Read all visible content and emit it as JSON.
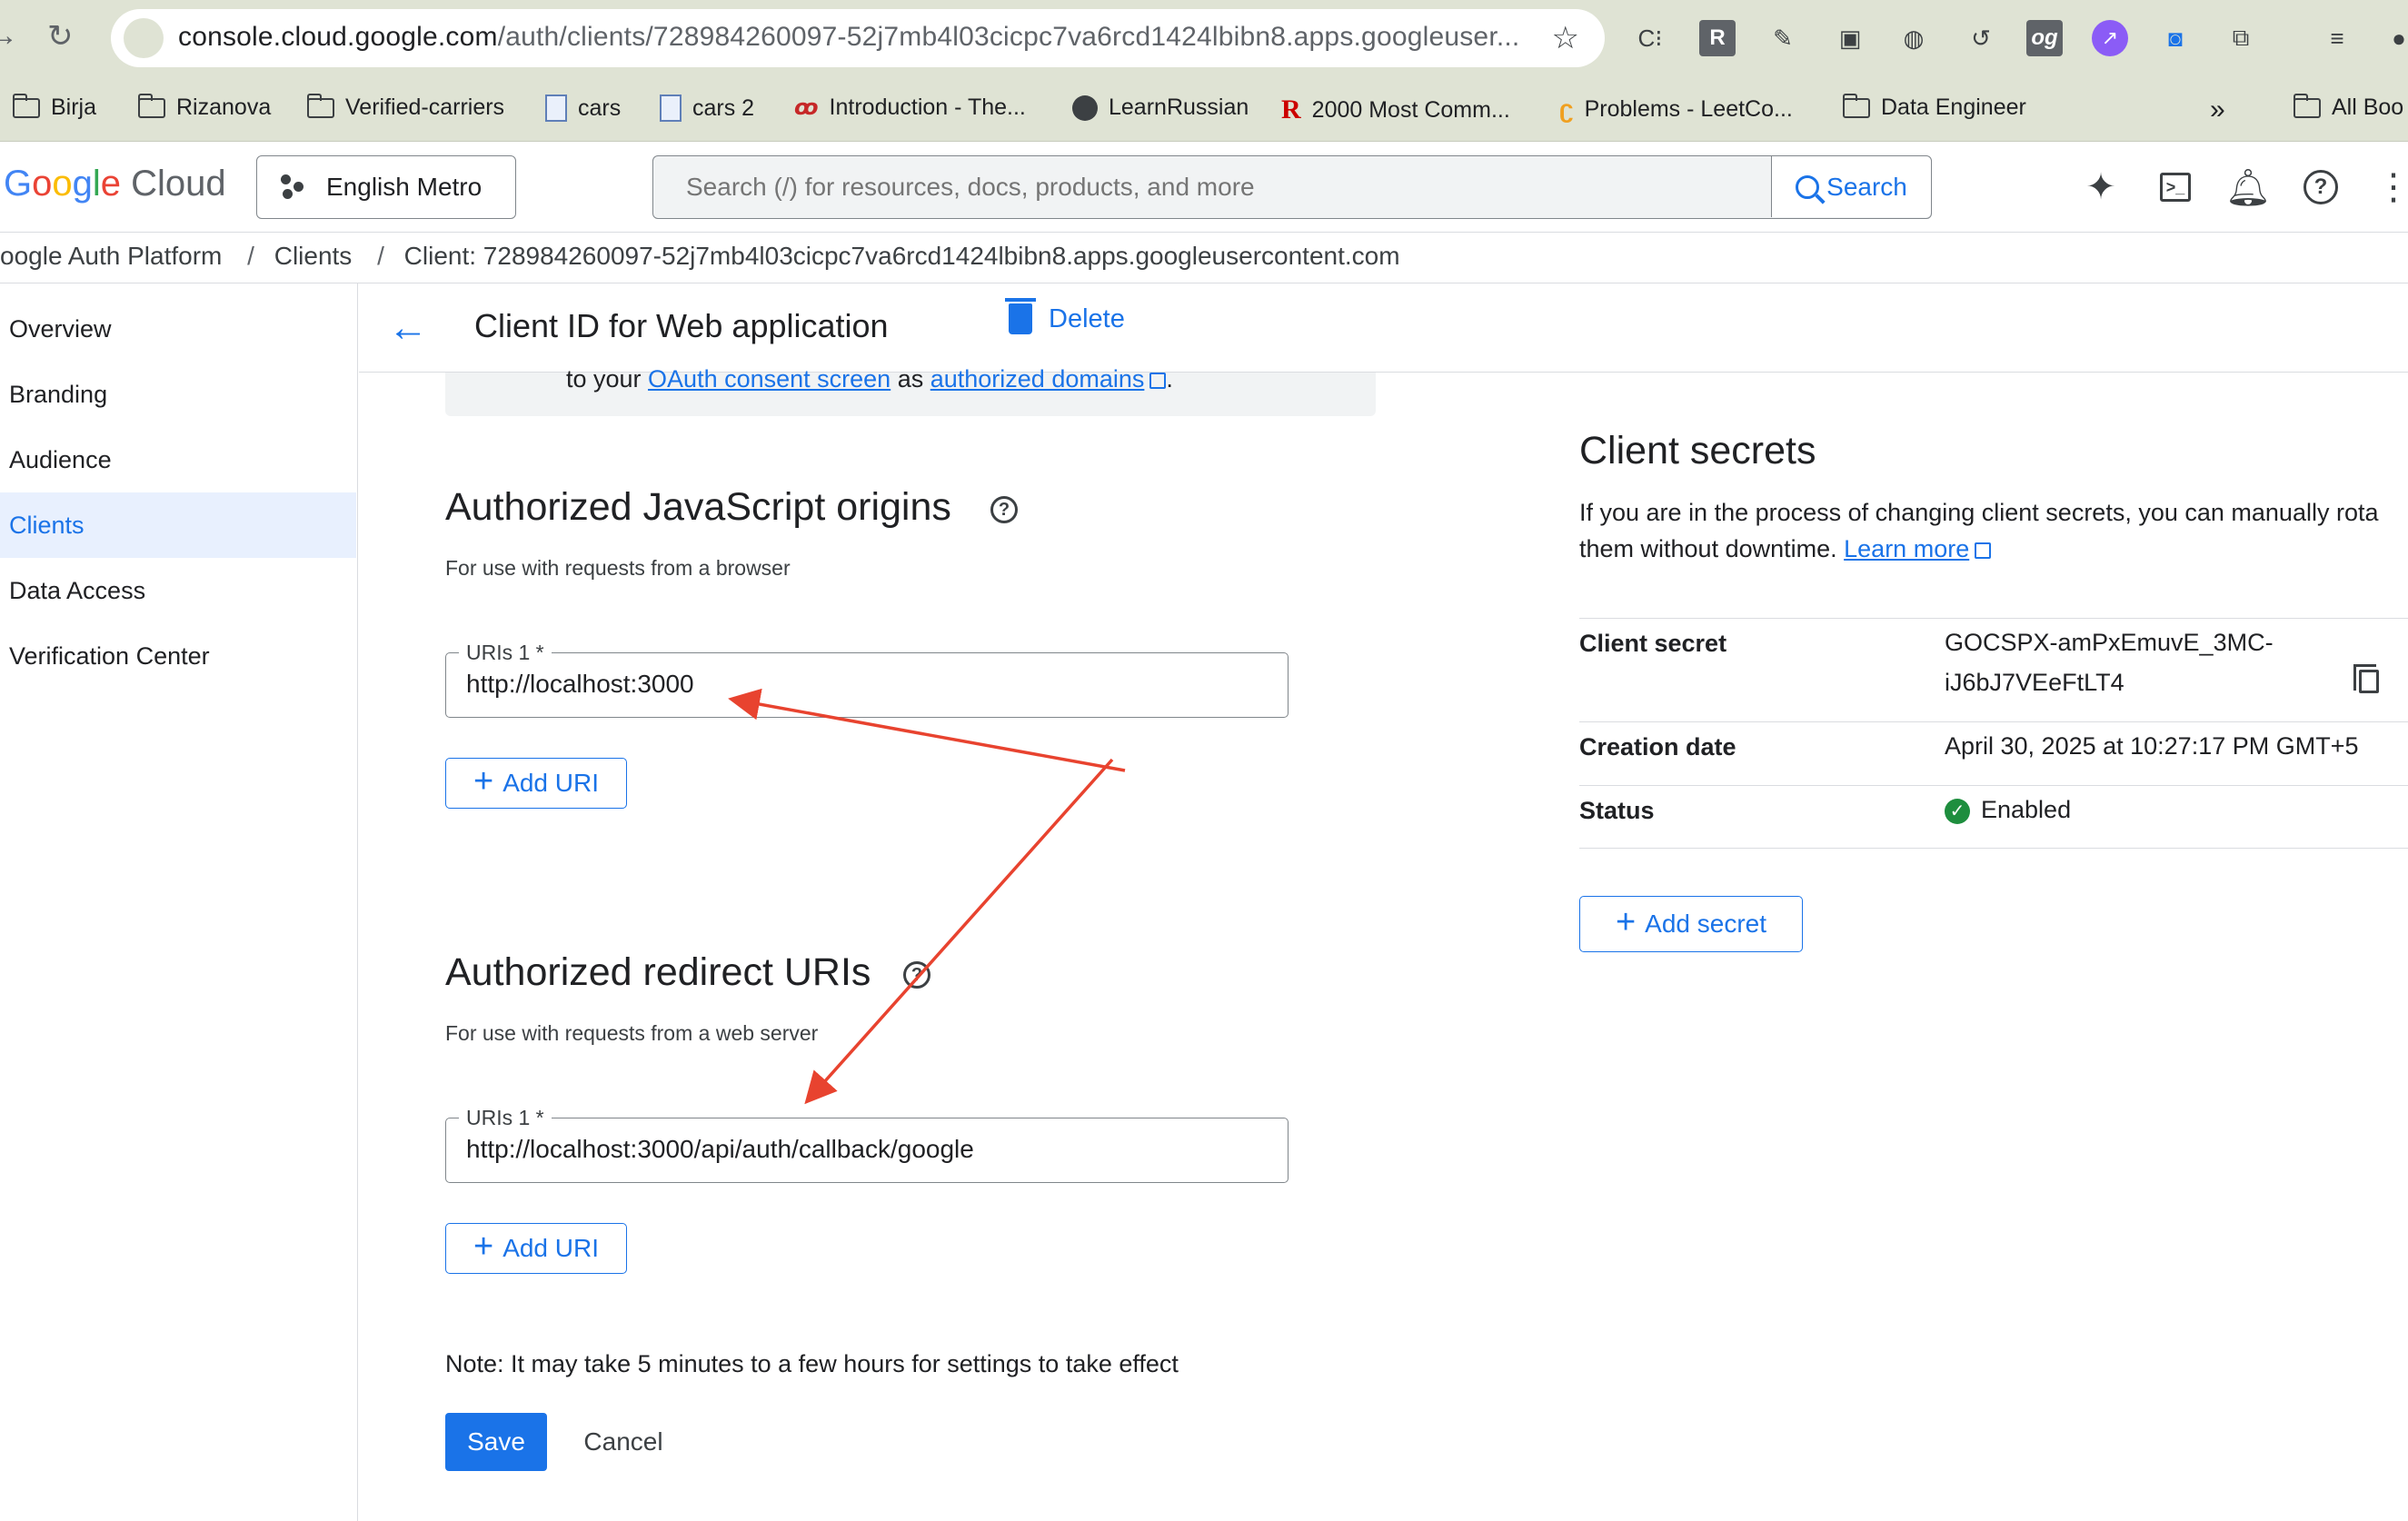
{
  "browser": {
    "url_host": "console.cloud.google.com",
    "url_path": "/auth/clients/728984260097-52j7mb4l03cicpc7va6rcd1424lbibn8.apps.googleuser...",
    "bookmarks": [
      {
        "label": "Birja",
        "icon": "folder-icon"
      },
      {
        "label": "Rizanova",
        "icon": "folder-icon"
      },
      {
        "label": "Verified-carriers",
        "icon": "folder-icon"
      },
      {
        "label": "cars",
        "icon": "doc-icon"
      },
      {
        "label": "cars 2",
        "icon": "doc-icon"
      },
      {
        "label": "Introduction - The...",
        "icon": "site-icon"
      },
      {
        "label": "LearnRussian",
        "icon": "globe-icon"
      },
      {
        "label": "2000 Most Comm...",
        "icon": "r-icon"
      },
      {
        "label": "Problems - LeetCo...",
        "icon": "leetcode-icon"
      },
      {
        "label": "Data Engineer",
        "icon": "folder-icon"
      },
      {
        "label": "All Boo",
        "icon": "folder-icon"
      }
    ],
    "overflow_label": "»",
    "ext_labels": {
      "r": "R",
      "og": "og"
    }
  },
  "header": {
    "logo_google": [
      "G",
      "o",
      "o",
      "g",
      "l",
      "e"
    ],
    "logo_cloud": "Cloud",
    "project": "English Metro",
    "search_placeholder": "Search (/) for resources, docs, products, and more",
    "search_button": "Search"
  },
  "breadcrumb": {
    "items": [
      "oogle Auth Platform",
      "Clients",
      "Client: 728984260097-52j7mb4l03cicpc7va6rcd1424lbibn8.apps.googleusercontent.com"
    ],
    "separator": "/"
  },
  "sidebar": {
    "items": [
      {
        "label": "Overview",
        "active": false
      },
      {
        "label": "Branding",
        "active": false
      },
      {
        "label": "Audience",
        "active": false
      },
      {
        "label": "Clients",
        "active": true
      },
      {
        "label": "Data Access",
        "active": false
      },
      {
        "label": "Verification Center",
        "active": false
      }
    ]
  },
  "titlebar": {
    "title": "Client ID for Web application",
    "delete": "Delete"
  },
  "info": {
    "prefix": "to your ",
    "link1": "OAuth consent screen",
    "middle": " as ",
    "link2": "authorized domains",
    "suffix": "."
  },
  "js_origins": {
    "title": "Authorized JavaScript origins",
    "subtitle": "For use with requests from a browser",
    "field_label": "URIs 1 *",
    "field_value": "http://localhost:3000",
    "add_button": "Add URI"
  },
  "redirect_uris": {
    "title": "Authorized redirect URIs",
    "subtitle": "For use with requests from a web server",
    "field_label": "URIs 1 *",
    "field_value": "http://localhost:3000/api/auth/callback/google",
    "add_button": "Add URI"
  },
  "footer": {
    "note": "Note: It may take 5 minutes to a few hours for settings to take effect",
    "save": "Save",
    "cancel": "Cancel"
  },
  "client_secrets": {
    "title": "Client secrets",
    "desc_line1": "If you are in the process of changing client secrets, you can manually rota",
    "desc_line2": "them without downtime. ",
    "learn_more": "Learn more",
    "rows": [
      {
        "key": "Client secret",
        "value_line1": "GOCSPX-amPxEmuvE_3MC-",
        "value_line2": "iJ6bJ7VEeFtLT4"
      },
      {
        "key": "Creation date",
        "value_line1": "April 30, 2025 at 10:27:17 PM GMT+5"
      },
      {
        "key": "Status",
        "value_line1": "Enabled"
      }
    ],
    "add_secret": "Add secret"
  },
  "colors": {
    "accent": "#1a73e8",
    "annotation_arrow": "#e8432f",
    "status_ok": "#1e8e3e"
  }
}
